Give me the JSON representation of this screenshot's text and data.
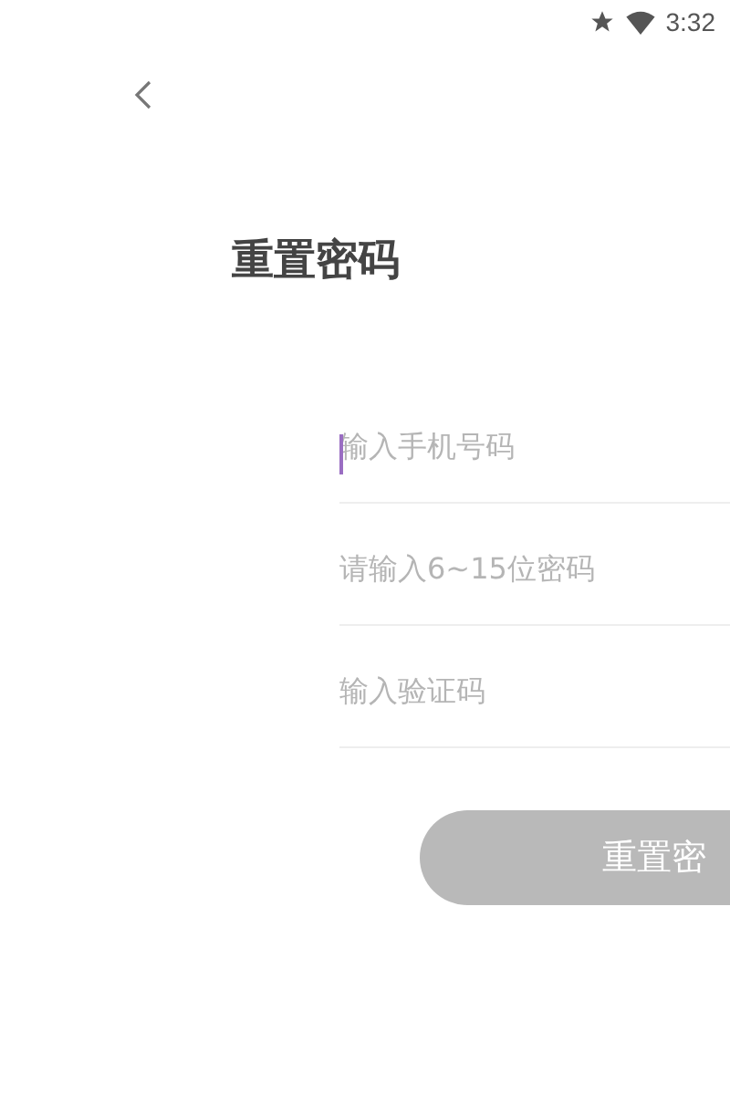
{
  "status_bar": {
    "time": "3:32"
  },
  "title": "重置密码",
  "fields": [
    {
      "placeholder": "输入手机号码",
      "focused": true
    },
    {
      "placeholder": "请输入6~15位密码",
      "focused": false
    },
    {
      "placeholder": "输入验证码",
      "focused": false
    }
  ],
  "submit_button": {
    "label": "重置密",
    "disabled": true
  }
}
